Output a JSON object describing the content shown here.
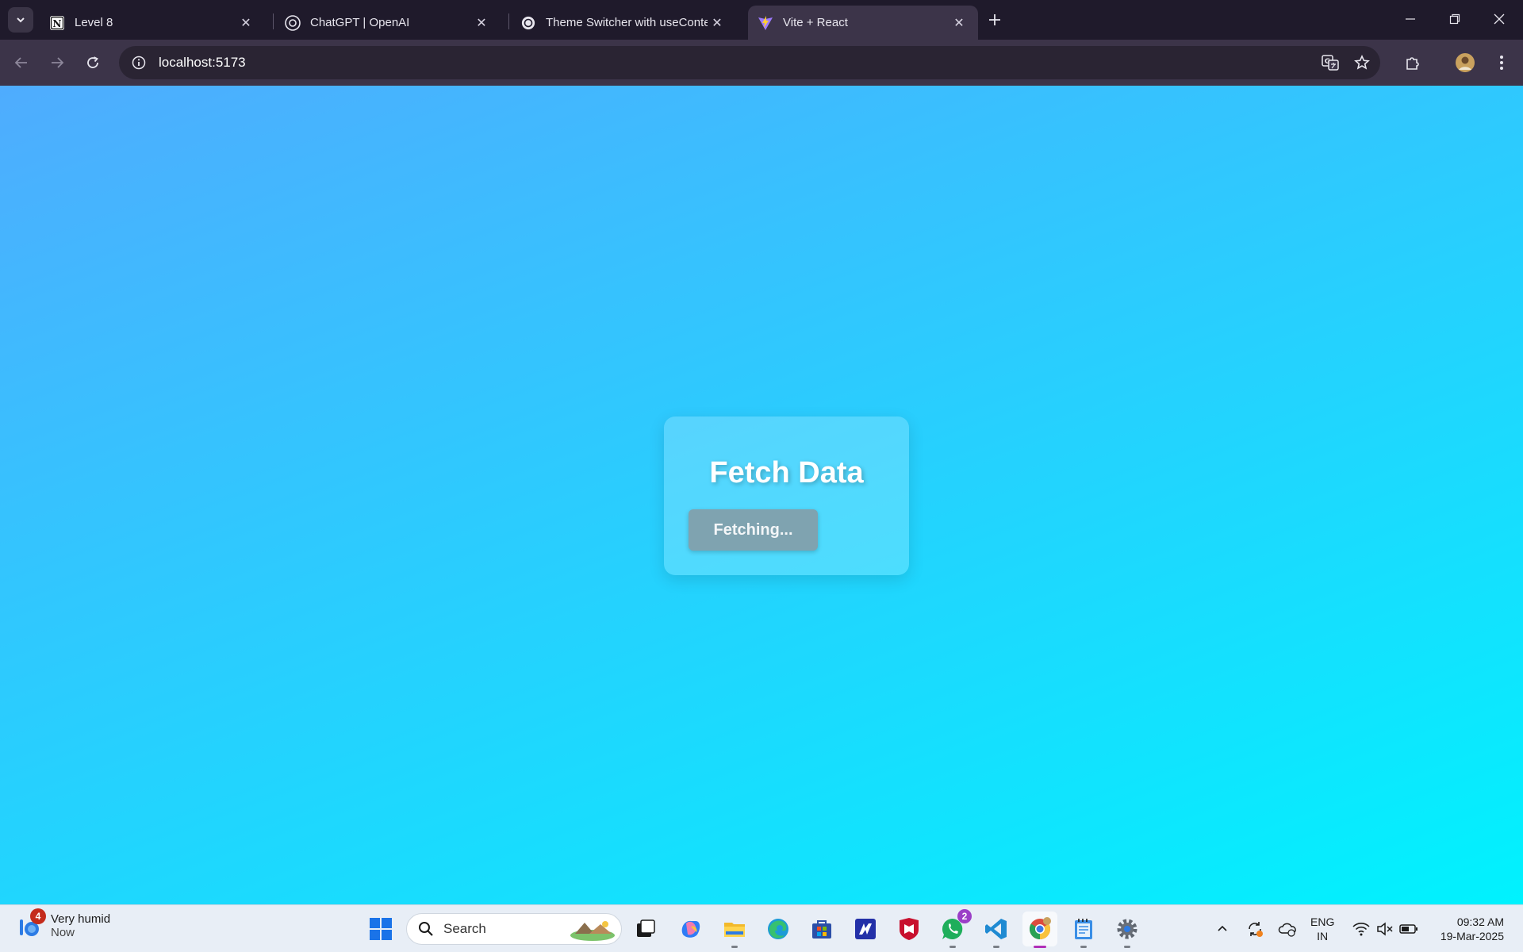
{
  "browser": {
    "tabs": [
      {
        "title": "Level 8",
        "icon": "notion-icon",
        "active": false
      },
      {
        "title": "ChatGPT | OpenAI",
        "icon": "openai-icon",
        "active": false
      },
      {
        "title": "Theme Switcher with useConte",
        "icon": "openai-icon",
        "active": false
      },
      {
        "title": "Vite + React",
        "icon": "vite-icon",
        "active": true
      }
    ],
    "address": "localhost:5173"
  },
  "page": {
    "background_colors": [
      "#4facfe",
      "#00f2fe"
    ],
    "card": {
      "title": "Fetch Data",
      "button_label": "Fetching..."
    }
  },
  "taskbar": {
    "weather": {
      "badge": "4",
      "title": "Very humid",
      "subtitle": "Now"
    },
    "search_label": "Search",
    "whatsapp_badge": "2",
    "language": {
      "line1": "ENG",
      "line2": "IN"
    },
    "time": "09:32 AM",
    "date": "19-Mar-2025"
  }
}
